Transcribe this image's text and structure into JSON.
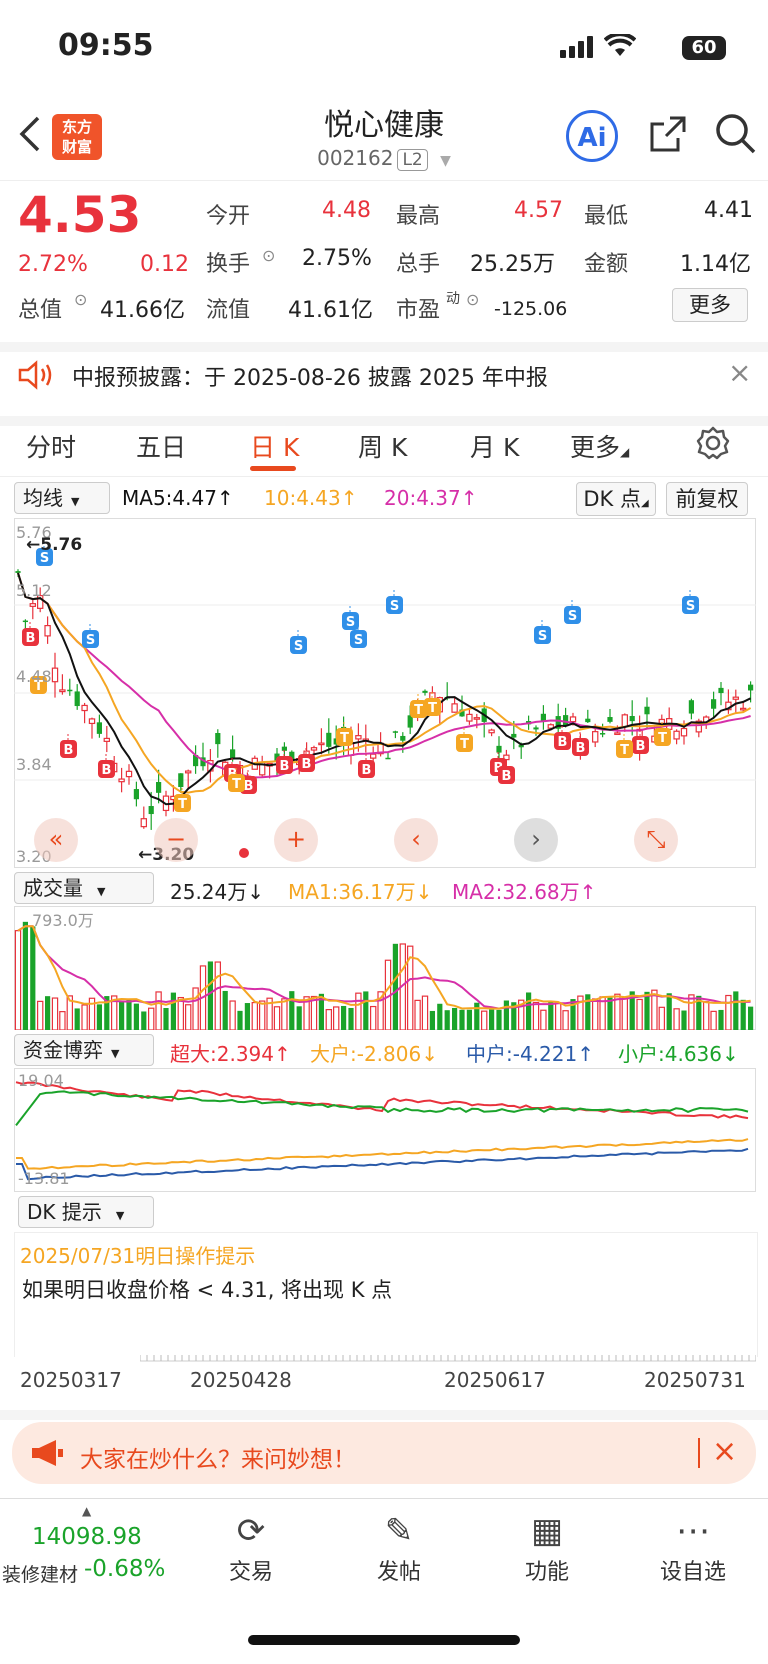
{
  "status": {
    "time": "09:55",
    "battery": "60"
  },
  "header": {
    "title": "悦心健康",
    "code": "002162",
    "level": "L2",
    "logo_line1": "东方",
    "logo_line2": "财富",
    "ai_label": "Ai"
  },
  "quote": {
    "price": "4.53",
    "pct": "2.72%",
    "change": "0.12",
    "open_label": "今开",
    "open": "4.48",
    "high_label": "最高",
    "high": "4.57",
    "low_label": "最低",
    "low": "4.41",
    "turnover_label": "换手",
    "turnover": "2.75%",
    "volume_label": "总手",
    "volume": "25.25万",
    "amount_label": "金额",
    "amount": "1.14亿",
    "mktcap_label": "总值",
    "mktcap": "41.66亿",
    "float_label": "流值",
    "float": "41.61亿",
    "pe_label": "市盈",
    "pe_sup": "动",
    "pe": "-125.06",
    "more": "更多"
  },
  "notice": {
    "text": "中报预披露：于 2025-08-26 披露 2025 年中报"
  },
  "tabs": [
    "分时",
    "五日",
    "日 K",
    "周 K",
    "月 K",
    "更多"
  ],
  "kline": {
    "indicator": "均线",
    "ma5": "MA5:4.47↑",
    "ma10": "10:4.43↑",
    "ma20": "20:4.37↑",
    "dk_btn": "DK 点",
    "adjust_btn": "前复权",
    "y_top": "5.76",
    "y_2": "5.12",
    "y_3": "4.48",
    "y_4": "3.84",
    "y_bottom": "3.20",
    "max_mark": "←5.76",
    "min_mark": "←3.20",
    "colors": {
      "up": "#e8323c",
      "down": "#1aa32a",
      "ma5": "#111111",
      "ma10": "#f5a623",
      "ma20": "#d62fa8"
    }
  },
  "volume": {
    "indicator": "成交量",
    "value": "25.24万↓",
    "ma1": "MA1:36.17万↓",
    "ma2": "MA2:32.68万↑",
    "y_top": "793.0万"
  },
  "fund": {
    "indicator": "资金博弈",
    "super": "超大:2.394↑",
    "big": "大户:-2.806↓",
    "mid": "中户:-4.221↑",
    "small": "小户:4.636↓",
    "y_top": "19.04",
    "y_bottom": "-13.81"
  },
  "dk": {
    "indicator": "DK 提示",
    "date_line": "2025/07/31明日操作提示",
    "message": "如果明日收盘价格 < 4.31, 将出现 K 点"
  },
  "dates": [
    "20250317",
    "20250428",
    "20250617",
    "20250731"
  ],
  "banner": {
    "text": "大家在炒什么？来问妙想！"
  },
  "bottom": {
    "index_value": "14098.98",
    "index_name": "装修建材",
    "index_pct": "-0.68%",
    "trade": "交易",
    "post": "发帖",
    "func": "功能",
    "watch": "设自选"
  }
}
